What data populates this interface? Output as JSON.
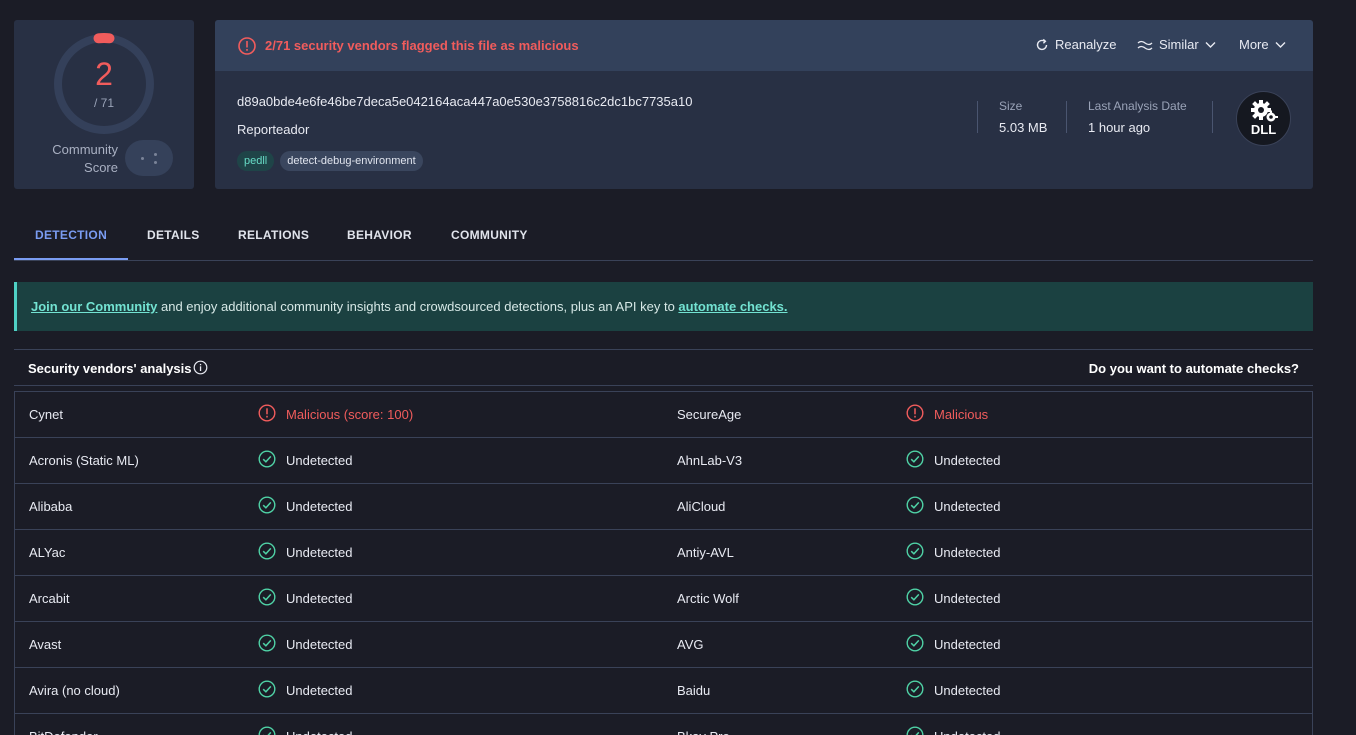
{
  "score": {
    "detections": "2",
    "total": "/ 71",
    "community_label_1": "Community",
    "community_label_2": "Score"
  },
  "header": {
    "alert": "2/71 security vendors flagged this file as malicious",
    "reanalyze": "Reanalyze",
    "similar": "Similar",
    "more": "More"
  },
  "file": {
    "hash": "d89a0bde4e6fe46be7deca5e042164aca447a0e530e3758816c2dc1bc7735a10",
    "name": "Reporteador",
    "tags": [
      "pedll",
      "detect-debug-environment"
    ],
    "size_label": "Size",
    "size": "5.03 MB",
    "last_analysis_label": "Last Analysis Date",
    "last_analysis": "1 hour ago",
    "type_badge": "DLL"
  },
  "tabs": [
    "DETECTION",
    "DETAILS",
    "RELATIONS",
    "BEHAVIOR",
    "COMMUNITY"
  ],
  "banner": {
    "link1": "Join our Community",
    "middle": " and enjoy additional community insights and crowdsourced detections, plus an API key to ",
    "link2": "automate checks."
  },
  "vendors_header": {
    "title": "Security vendors' analysis",
    "right": "Do you want to automate checks?"
  },
  "vendors": [
    [
      {
        "name": "Cynet",
        "result": "Malicious (score: 100)",
        "status": "malicious"
      },
      {
        "name": "SecureAge",
        "result": "Malicious",
        "status": "malicious"
      }
    ],
    [
      {
        "name": "Acronis (Static ML)",
        "result": "Undetected",
        "status": "undetected"
      },
      {
        "name": "AhnLab-V3",
        "result": "Undetected",
        "status": "undetected"
      }
    ],
    [
      {
        "name": "Alibaba",
        "result": "Undetected",
        "status": "undetected"
      },
      {
        "name": "AliCloud",
        "result": "Undetected",
        "status": "undetected"
      }
    ],
    [
      {
        "name": "ALYac",
        "result": "Undetected",
        "status": "undetected"
      },
      {
        "name": "Antiy-AVL",
        "result": "Undetected",
        "status": "undetected"
      }
    ],
    [
      {
        "name": "Arcabit",
        "result": "Undetected",
        "status": "undetected"
      },
      {
        "name": "Arctic Wolf",
        "result": "Undetected",
        "status": "undetected"
      }
    ],
    [
      {
        "name": "Avast",
        "result": "Undetected",
        "status": "undetected"
      },
      {
        "name": "AVG",
        "result": "Undetected",
        "status": "undetected"
      }
    ],
    [
      {
        "name": "Avira (no cloud)",
        "result": "Undetected",
        "status": "undetected"
      },
      {
        "name": "Baidu",
        "result": "Undetected",
        "status": "undetected"
      }
    ],
    [
      {
        "name": "BitDefender",
        "result": "Undetected",
        "status": "undetected"
      },
      {
        "name": "Bkav Pro",
        "result": "Undetected",
        "status": "undetected"
      }
    ]
  ],
  "colors": {
    "malicious": "#f15c5c",
    "undetected": "#4fd1a5",
    "accent": "#7a9cf2"
  }
}
